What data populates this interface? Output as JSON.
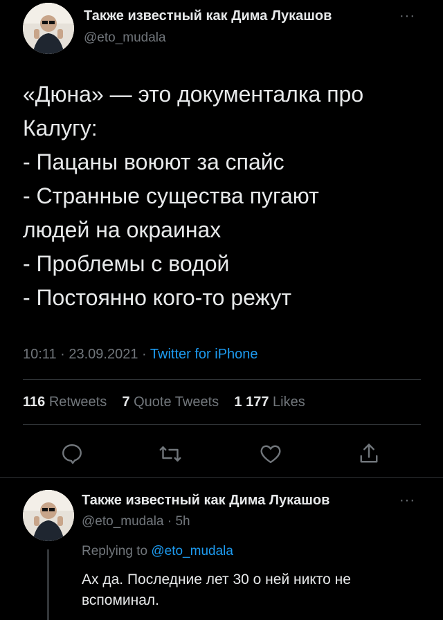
{
  "tweet": {
    "author_name": "Также известный как Дима Лукашов",
    "author_handle": "@eto_mudala",
    "more_label": "···",
    "lines": [
      "«Дюна» — это документалка про",
      "Калугу:",
      "- Пацаны воюют за спайс",
      "- Странные существа пугают",
      "людей на окраинах",
      "- Проблемы с водой",
      "- Постоянно кого-то режут"
    ],
    "time": "10:11",
    "sep1": "·",
    "date": "23.09.2021",
    "sep2": "·",
    "source": "Twitter for iPhone",
    "stats": {
      "retweets_count": "116",
      "retweets_label": "Retweets",
      "quotes_count": "7",
      "quotes_label": "Quote Tweets",
      "likes_count": "1 177",
      "likes_label": "Likes"
    }
  },
  "reply": {
    "author_name": "Также известный как Дима Лукашов",
    "author_handle": "@eto_mudala",
    "sep": "·",
    "age": "5h",
    "more_label": "···",
    "replying_to_label": "Replying to",
    "replying_to_handle": "@eto_mudala",
    "lines": [
      "Ах да. Последние лет 30 о ней никто не",
      "вспоминал."
    ]
  },
  "icons": [
    "reply-icon",
    "retweet-icon",
    "like-icon",
    "share-icon",
    "more-icon"
  ],
  "colors": {
    "background": "#000000",
    "text": "#e7e9ea",
    "muted": "#71767b",
    "link": "#1d9bf0",
    "divider": "#2f3336"
  }
}
